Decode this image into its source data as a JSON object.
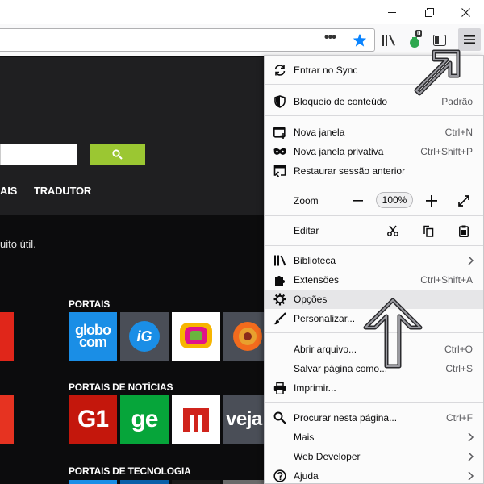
{
  "window": {
    "minimize_icon": "minimize-icon",
    "restore_icon": "restore-icon",
    "close_icon": "close-icon"
  },
  "toolbar": {
    "page_actions_label": "•••",
    "addon_badge": "0",
    "icons": [
      "page-actions-icon",
      "bookmark-star-icon",
      "library-icon",
      "addon-icon",
      "sidebar-icon",
      "hamburger-menu-icon"
    ],
    "star_color": "#0a84ff"
  },
  "page": {
    "nav": [
      {
        "label": "AIS"
      },
      {
        "label": "TRADUTOR"
      }
    ],
    "tip": "uito útil.",
    "search_button_color": "#9bc732",
    "sections": [
      {
        "title": "PORTAIS",
        "tiles": [
          "globo.com",
          "iG",
          "UOL",
          "Terra"
        ]
      },
      {
        "title": "PORTAIS DE NOTÍCIAS",
        "tiles": [
          "G1",
          "ge",
          "M",
          "veja"
        ]
      },
      {
        "title": "PORTAIS DE TECNOLOGIA"
      }
    ],
    "tile_text": {
      "globo_1": "globo",
      "globo_2": "com",
      "ig": "iG",
      "g1": "G1",
      "ge": "ge",
      "veja": "veja"
    }
  },
  "menu": {
    "sync": "Entrar no Sync",
    "content_blocking": "Bloqueio de conteúdo",
    "content_blocking_value": "Padrão",
    "new_window": "Nova janela",
    "new_window_shortcut": "Ctrl+N",
    "private_window": "Nova janela privativa",
    "private_window_shortcut": "Ctrl+Shift+P",
    "restore_session": "Restaurar sessão anterior",
    "zoom": "Zoom",
    "zoom_minus": "—",
    "zoom_value": "100%",
    "zoom_plus": "+",
    "edit": "Editar",
    "library": "Biblioteca",
    "addons": "Extensões",
    "addons_shortcut": "Ctrl+Shift+A",
    "options": "Opções",
    "customize": "Personalizar...",
    "open_file": "Abrir arquivo...",
    "open_file_shortcut": "Ctrl+O",
    "save_page": "Salvar página como...",
    "save_page_shortcut": "Ctrl+S",
    "print": "Imprimir...",
    "find": "Procurar nesta página...",
    "find_shortcut": "Ctrl+F",
    "more": "Mais",
    "web_developer": "Web Developer",
    "help": "Ajuda"
  }
}
